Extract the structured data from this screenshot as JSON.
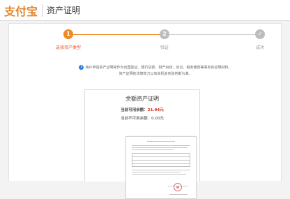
{
  "header": {
    "logo_text": "支付宝",
    "title": "资产证明"
  },
  "steps": [
    {
      "number": "1",
      "label": "选择资产类型",
      "state": "active"
    },
    {
      "number": "2",
      "label": "验证",
      "state": "todo"
    },
    {
      "number": "✓",
      "label": "成功",
      "state": "todo"
    }
  ],
  "notice": {
    "icon": "info-icon",
    "line1": "用户申请资产证明常作为出国签证、银行贷款、财产纠纷、诉讼、税务稽查等事务的证明材料，",
    "line2": "资产证明的法律效力以有关机关实际判断为准。"
  },
  "certificate": {
    "title": "余额资产证明",
    "available_label": "当前可用余额：",
    "available_value": "21.94元",
    "unavailable_label": "当前不可用余额：",
    "unavailable_value": "0.00元"
  },
  "colors": {
    "brand_orange": "#f08a24",
    "accent_red": "#e2231a",
    "info_blue": "#2f7fd6"
  }
}
